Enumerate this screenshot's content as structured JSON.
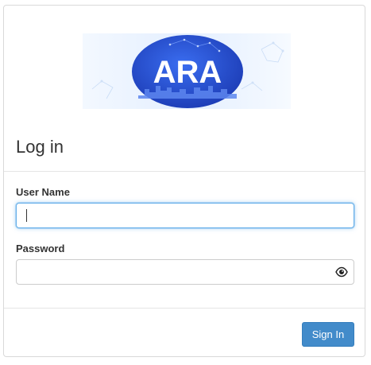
{
  "logo": {
    "text": "ARA",
    "icon": "ara-logo"
  },
  "form": {
    "title": "Log in",
    "username": {
      "label": "User Name",
      "value": "",
      "placeholder": ""
    },
    "password": {
      "label": "Password",
      "value": "",
      "placeholder": ""
    },
    "toggle_icon": "eye-icon",
    "submit_label": "Sign In"
  },
  "colors": {
    "primary": "#428bca",
    "focus": "#66afe9",
    "logo_blue": "#2a4fcf"
  }
}
